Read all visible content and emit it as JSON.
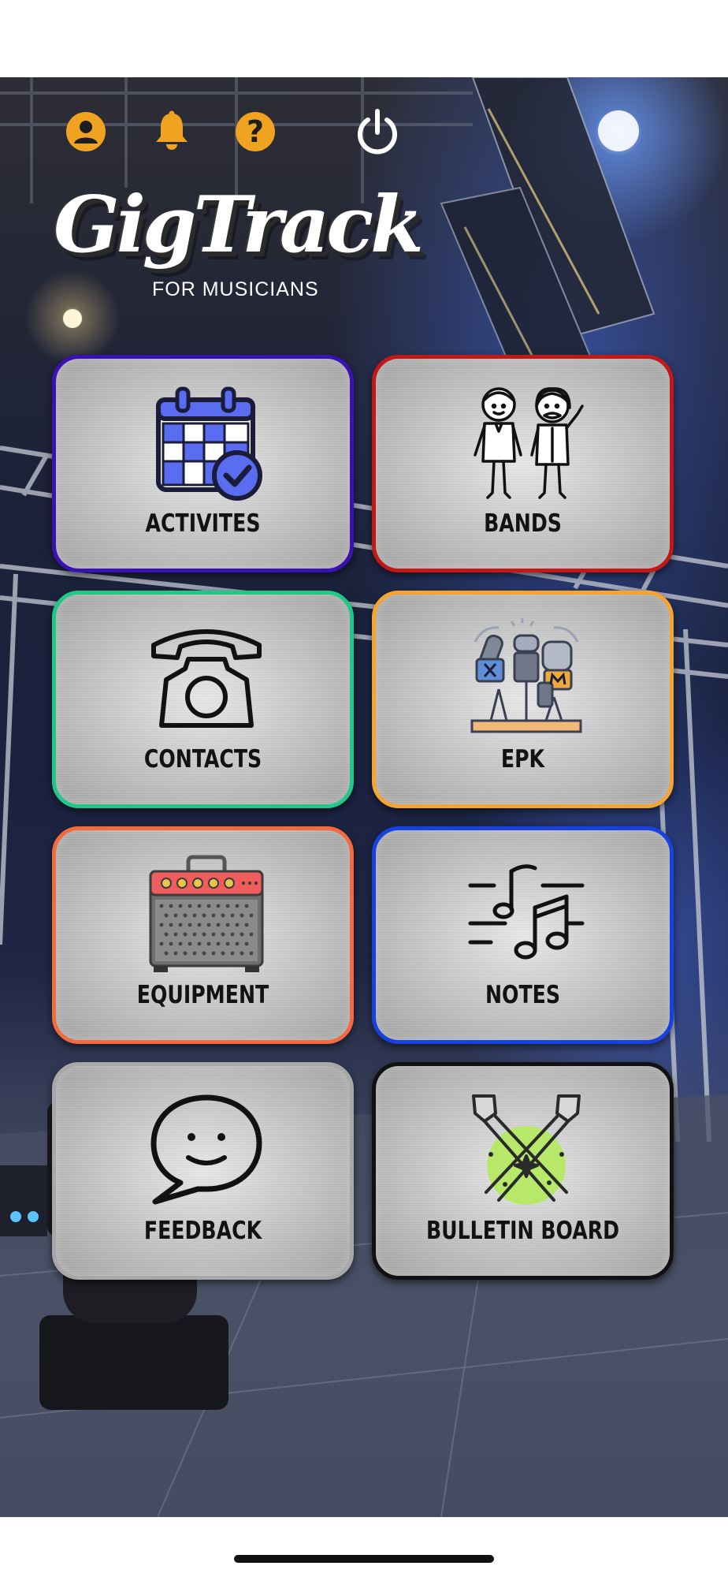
{
  "app": {
    "title": "GigTrack",
    "subtitle": "FOR MUSICIANS"
  },
  "header_icons": [
    {
      "name": "profile-icon"
    },
    {
      "name": "bell-icon"
    },
    {
      "name": "help-icon",
      "glyph": "?"
    },
    {
      "name": "power-icon"
    }
  ],
  "colors": {
    "header_icon": "#f0a320",
    "power_icon": "#ffffff"
  },
  "tiles": [
    {
      "label": "ACTIVITES",
      "icon": "calendar-check-icon",
      "border": "#3a12b4"
    },
    {
      "label": "BANDS",
      "icon": "band-members-icon",
      "border": "#c21818"
    },
    {
      "label": "CONTACTS",
      "icon": "telephone-icon",
      "border": "#20c888"
    },
    {
      "label": "EPK",
      "icon": "press-microphones-icon",
      "border": "#f5a431"
    },
    {
      "label": "EQUIPMENT",
      "icon": "amplifier-icon",
      "border": "#f26a3d"
    },
    {
      "label": "NOTES",
      "icon": "music-notes-icon",
      "border": "#1742e0"
    },
    {
      "label": "FEEDBACK",
      "icon": "speech-bubble-icon",
      "border": "#a8a8a8"
    },
    {
      "label": "BULLETIN BOARD",
      "icon": "spotlights-icon",
      "border": "#111111"
    }
  ]
}
